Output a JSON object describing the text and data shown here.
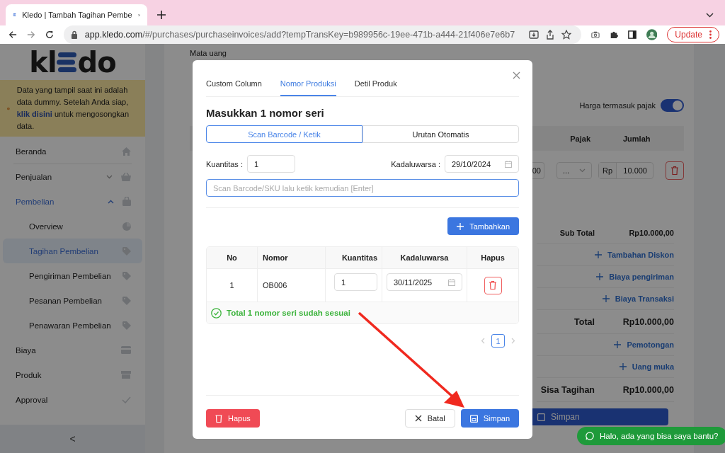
{
  "browser": {
    "tab_title": "Kledo | Tambah Tagihan Pembe",
    "url_host": "app.kledo.com",
    "url_path": "/#/purchases/purchaseinvoices/add?tempTransKey=b989956c-19ee-471b-a444-21f406e7e6b7",
    "update_label": "Update"
  },
  "sidebar": {
    "logo_left": "kl",
    "logo_right": "do",
    "notice": {
      "text_before": "Data yang tampil saat ini adalah data dummy. Setelah Anda siap, ",
      "link": "klik disini",
      "text_after": " untuk mengosongkan data."
    },
    "items": [
      {
        "label": "Beranda",
        "selected": false
      },
      {
        "label": "Penjualan",
        "selected": false,
        "expanded": false
      },
      {
        "label": "Pembelian",
        "selected": true,
        "expanded": true,
        "children": [
          {
            "label": "Overview",
            "selected": false
          },
          {
            "label": "Tagihan Pembelian",
            "selected": true
          },
          {
            "label": "Pengiriman Pembelian",
            "selected": false
          },
          {
            "label": "Pesanan Pembelian",
            "selected": false
          },
          {
            "label": "Penawaran Pembelian",
            "selected": false
          }
        ]
      },
      {
        "label": "Biaya",
        "selected": false
      },
      {
        "label": "Produk",
        "selected": false
      },
      {
        "label": "Approval",
        "selected": false
      }
    ],
    "collapse": "<"
  },
  "main": {
    "currency_label": "Mata uang",
    "tax_inclusive": {
      "label": "Harga termasuk pajak",
      "on": true
    },
    "columns": [
      "Pajak",
      "Jumlah"
    ],
    "row": {
      "cell_1": "00",
      "tax": "...",
      "currency": "Rp",
      "amount": "10.000"
    },
    "summary": [
      {
        "kind": "total",
        "label": "Sub Total",
        "value": "Rp10.000,00"
      },
      {
        "kind": "link",
        "label": "Tambahan Diskon"
      },
      {
        "kind": "link",
        "label": "Biaya pengiriman"
      },
      {
        "kind": "link",
        "label": "Biaya Transaksi"
      },
      {
        "kind": "grand",
        "label": "Total",
        "value": "Rp10.000,00"
      },
      {
        "kind": "link",
        "label": "Pemotongan"
      },
      {
        "kind": "link",
        "label": "Uang muka"
      },
      {
        "kind": "grand",
        "label": "Sisa Tagihan",
        "value": "Rp10.000,00"
      }
    ],
    "save_label": "Simpan"
  },
  "modal": {
    "tabs": [
      {
        "label": "Custom Column",
        "selected": false
      },
      {
        "label": "Nomor Produksi",
        "selected": true
      },
      {
        "label": "Detil Produk",
        "selected": false
      }
    ],
    "heading": "Masukkan 1 nomor seri",
    "modes": [
      {
        "label": "Scan Barcode / Ketik",
        "selected": true
      },
      {
        "label": "Urutan Otomatis",
        "selected": false
      }
    ],
    "quantity": {
      "label": "Kuantitas :",
      "value": "1"
    },
    "expiry": {
      "label": "Kadaluwarsa :",
      "value": "29/10/2024"
    },
    "scan": {
      "placeholder": "Scan Barcode/SKU lalu ketik kemudian [Enter]"
    },
    "add_label": "Tambahkan",
    "columns": [
      "No",
      "Nomor",
      "Kuantitas",
      "Kadaluwarsa",
      "Hapus"
    ],
    "rows": [
      {
        "no": "1",
        "nomor": "OB006",
        "qty": "1",
        "expiry": "30/11/2025"
      }
    ],
    "status": "Total 1 nomor seri sudah sesuai",
    "pages": [
      {
        "label": "1",
        "selected": true
      }
    ],
    "delete_label": "Hapus",
    "cancel_label": "Batal",
    "save_label": "Simpan"
  },
  "chat": {
    "label": "Halo, ada yang bisa saya bantu?"
  }
}
